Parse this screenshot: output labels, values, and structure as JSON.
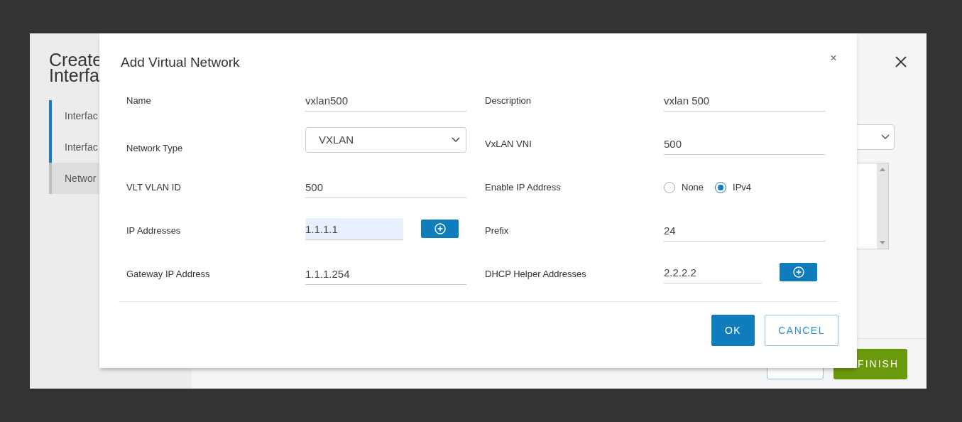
{
  "wizard": {
    "title_lines": [
      "Create",
      "Interfa"
    ],
    "steps": [
      {
        "label": "Interfac",
        "selected": false
      },
      {
        "label": "Interfac",
        "selected": false
      },
      {
        "label": "Networ",
        "selected": true
      }
    ],
    "finish_button": "FINISH"
  },
  "dialog": {
    "title": "Add Virtual Network",
    "close": "×",
    "left_fields": [
      {
        "kind": "text",
        "label": "Name",
        "value": "vxlan500"
      },
      {
        "kind": "select",
        "label": "Network Type",
        "value": "VXLAN"
      },
      {
        "kind": "text",
        "label": "VLT VLAN ID",
        "value": "500"
      },
      {
        "kind": "add",
        "label": "IP Addresses",
        "value": "1.1.1.1",
        "highlighted": true
      },
      {
        "kind": "text",
        "label": "Gateway IP Address",
        "value": "1.1.1.254"
      }
    ],
    "right_fields": [
      {
        "kind": "text",
        "label": "Description",
        "value": "vxlan 500"
      },
      {
        "kind": "text",
        "label": "VxLAN VNI",
        "value": "500"
      },
      {
        "kind": "radio",
        "label": "Enable IP Address",
        "options": [
          {
            "label": "None",
            "selected": false
          },
          {
            "label": "IPv4",
            "selected": true
          }
        ]
      },
      {
        "kind": "text",
        "label": "Prefix",
        "value": "24"
      },
      {
        "kind": "add",
        "label": "DHCP Helper Addresses",
        "value": "2.2.2.2",
        "highlighted": false
      }
    ],
    "buttons": [
      {
        "kind": "primary",
        "label": "OK"
      },
      {
        "kind": "outline",
        "label": "CANCEL"
      }
    ]
  }
}
